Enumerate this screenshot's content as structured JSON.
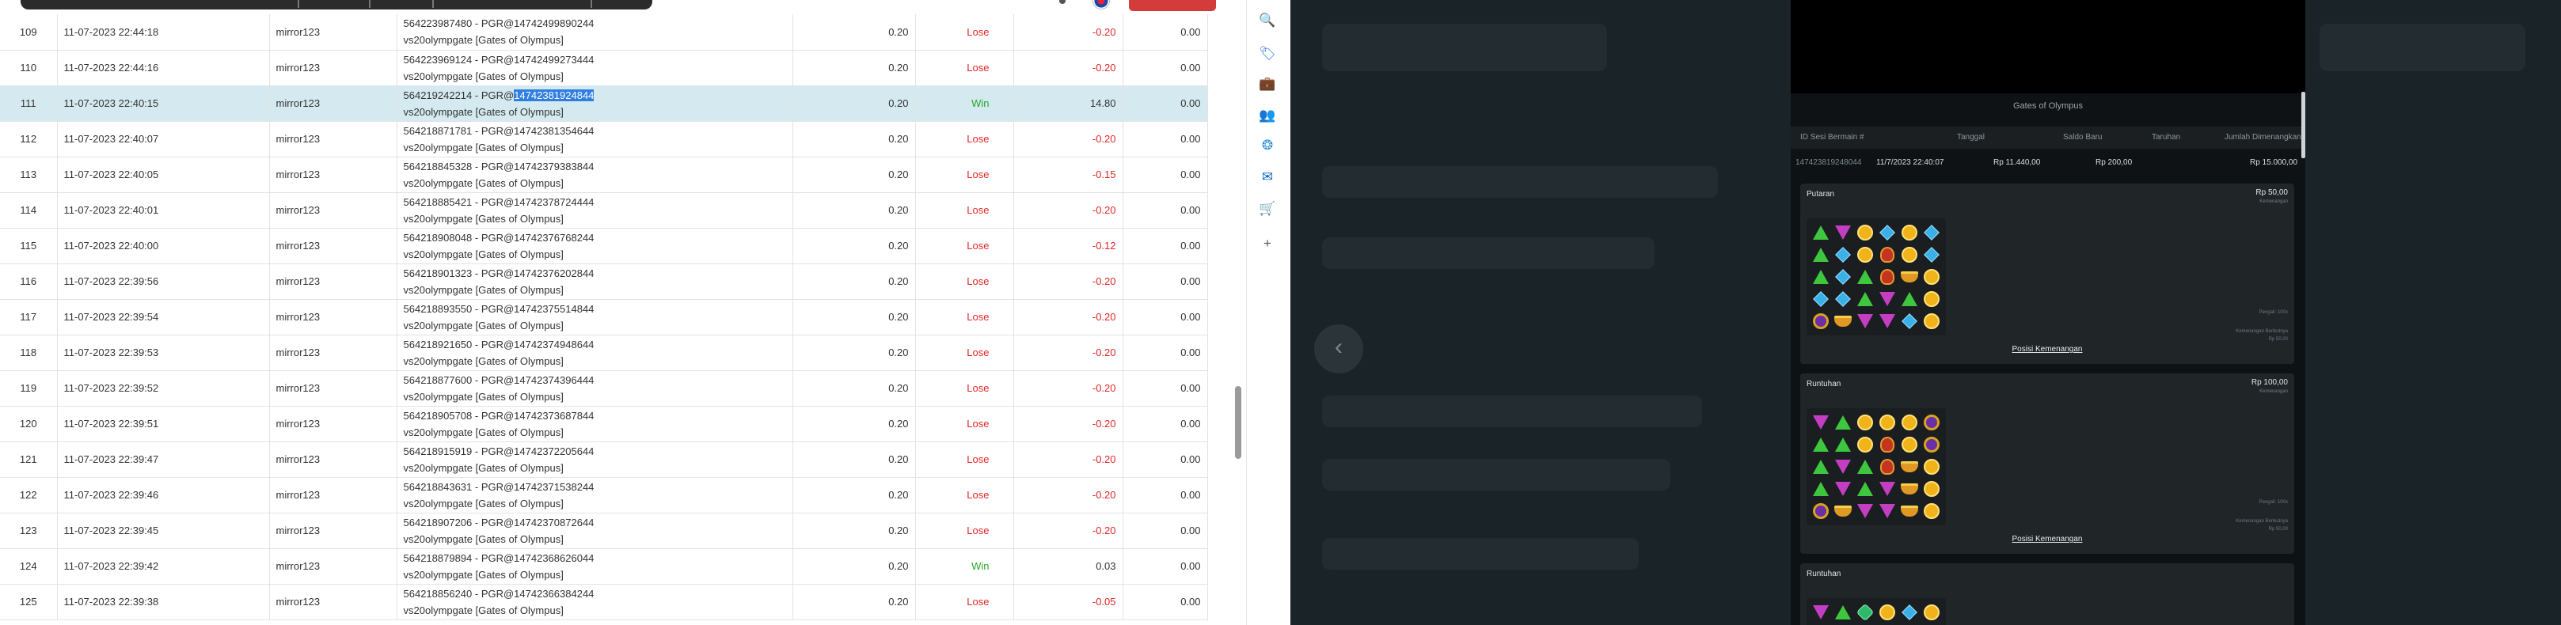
{
  "table": {
    "rows": [
      {
        "no": "109",
        "datetime": "11-07-2023 22:44:18",
        "user": "mirror123",
        "desc1": "564223987480 - PGR@14742499890244",
        "desc2": "vs20olympgate [Gates of Olympus]",
        "bet": "0.20",
        "result": "Lose",
        "winloss": "-0.20",
        "extra": "0.00"
      },
      {
        "no": "110",
        "datetime": "11-07-2023 22:44:16",
        "user": "mirror123",
        "desc1": "564223969124 - PGR@14742499273444",
        "desc2": "vs20olympgate [Gates of Olympus]",
        "bet": "0.20",
        "result": "Lose",
        "winloss": "-0.20",
        "extra": "0.00"
      },
      {
        "no": "111",
        "datetime": "11-07-2023 22:40:15",
        "user": "mirror123",
        "desc1": "564219242214 - PGR@",
        "desc1_hl": "14742381924844",
        "desc2": "vs20olympgate [Gates of Olympus]",
        "bet": "0.20",
        "result": "Win",
        "winloss": "14.80",
        "extra": "0.00",
        "selected": true
      },
      {
        "no": "112",
        "datetime": "11-07-2023 22:40:07",
        "user": "mirror123",
        "desc1": "564218871781 - PGR@14742381354644",
        "desc2": "vs20olympgate [Gates of Olympus]",
        "bet": "0.20",
        "result": "Lose",
        "winloss": "-0.20",
        "extra": "0.00"
      },
      {
        "no": "113",
        "datetime": "11-07-2023 22:40:05",
        "user": "mirror123",
        "desc1": "564218845328 - PGR@14742379383844",
        "desc2": "vs20olympgate [Gates of Olympus]",
        "bet": "0.20",
        "result": "Lose",
        "winloss": "-0.15",
        "extra": "0.00"
      },
      {
        "no": "114",
        "datetime": "11-07-2023 22:40:01",
        "user": "mirror123",
        "desc1": "564218885421 - PGR@14742378724444",
        "desc2": "vs20olympgate [Gates of Olympus]",
        "bet": "0.20",
        "result": "Lose",
        "winloss": "-0.20",
        "extra": "0.00"
      },
      {
        "no": "115",
        "datetime": "11-07-2023 22:40:00",
        "user": "mirror123",
        "desc1": "564218908048 - PGR@14742376768244",
        "desc2": "vs20olympgate [Gates of Olympus]",
        "bet": "0.20",
        "result": "Lose",
        "winloss": "-0.12",
        "extra": "0.00"
      },
      {
        "no": "116",
        "datetime": "11-07-2023 22:39:56",
        "user": "mirror123",
        "desc1": "564218901323 - PGR@14742376202844",
        "desc2": "vs20olympgate [Gates of Olympus]",
        "bet": "0.20",
        "result": "Lose",
        "winloss": "-0.20",
        "extra": "0.00"
      },
      {
        "no": "117",
        "datetime": "11-07-2023 22:39:54",
        "user": "mirror123",
        "desc1": "564218893550 - PGR@14742375514844",
        "desc2": "vs20olympgate [Gates of Olympus]",
        "bet": "0.20",
        "result": "Lose",
        "winloss": "-0.20",
        "extra": "0.00"
      },
      {
        "no": "118",
        "datetime": "11-07-2023 22:39:53",
        "user": "mirror123",
        "desc1": "564218921650 - PGR@14742374948644",
        "desc2": "vs20olympgate [Gates of Olympus]",
        "bet": "0.20",
        "result": "Lose",
        "winloss": "-0.20",
        "extra": "0.00"
      },
      {
        "no": "119",
        "datetime": "11-07-2023 22:39:52",
        "user": "mirror123",
        "desc1": "564218877600 - PGR@14742374396444",
        "desc2": "vs20olympgate [Gates of Olympus]",
        "bet": "0.20",
        "result": "Lose",
        "winloss": "-0.20",
        "extra": "0.00"
      },
      {
        "no": "120",
        "datetime": "11-07-2023 22:39:51",
        "user": "mirror123",
        "desc1": "564218905708 - PGR@14742373687844",
        "desc2": "vs20olympgate [Gates of Olympus]",
        "bet": "0.20",
        "result": "Lose",
        "winloss": "-0.20",
        "extra": "0.00"
      },
      {
        "no": "121",
        "datetime": "11-07-2023 22:39:47",
        "user": "mirror123",
        "desc1": "564218915919 - PGR@14742372205644",
        "desc2": "vs20olympgate [Gates of Olympus]",
        "bet": "0.20",
        "result": "Lose",
        "winloss": "-0.20",
        "extra": "0.00"
      },
      {
        "no": "122",
        "datetime": "11-07-2023 22:39:46",
        "user": "mirror123",
        "desc1": "564218843631 - PGR@14742371538244",
        "desc2": "vs20olympgate [Gates of Olympus]",
        "bet": "0.20",
        "result": "Lose",
        "winloss": "-0.20",
        "extra": "0.00"
      },
      {
        "no": "123",
        "datetime": "11-07-2023 22:39:45",
        "user": "mirror123",
        "desc1": "564218907206 - PGR@14742370872644",
        "desc2": "vs20olympgate [Gates of Olympus]",
        "bet": "0.20",
        "result": "Lose",
        "winloss": "-0.20",
        "extra": "0.00"
      },
      {
        "no": "124",
        "datetime": "11-07-2023 22:39:42",
        "user": "mirror123",
        "desc1": "564218879894 - PGR@14742368626044",
        "desc2": "vs20olympgate [Gates of Olympus]",
        "bet": "0.20",
        "result": "Win",
        "winloss": "0.03",
        "extra": "0.00"
      },
      {
        "no": "125",
        "datetime": "11-07-2023 22:39:38",
        "user": "mirror123",
        "desc1": "564218856240 - PGR@14742366384244",
        "desc2": "vs20olympgate [Gates of Olympus]",
        "bet": "0.20",
        "result": "Lose",
        "winloss": "-0.05",
        "extra": "0.00"
      }
    ]
  },
  "sidebar_icons": [
    "search-icon",
    "tag-icon",
    "briefcase-icon",
    "people-icon",
    "copilot-icon",
    "outlook-icon",
    "shopping-icon",
    "add-icon"
  ],
  "sidebar_glyphs": [
    "🔍",
    "🏷",
    "💼",
    "👥",
    "❂",
    "✉",
    "🛒",
    "+"
  ],
  "sidebar_colors": [
    "#1e6fd9",
    "#2a7ae2",
    "#c8502a",
    "#7b4fc0",
    "#2f8fd8",
    "#0a64c8",
    "#1aa06b",
    "#555555"
  ],
  "modal": {
    "title": "Gates of Olympus",
    "headers": [
      "ID Sesi Bermain #",
      "Tanggal",
      "Saldo Baru",
      "Taruhan",
      "Jumlah Dimenangkan"
    ],
    "row": [
      "147423819248044",
      "11/7/2023 22:40:07",
      "Rp 11.440,00",
      "Rp 200,00",
      "Rp 15.000,00"
    ],
    "panels": [
      {
        "title": "Putaran",
        "amount": "Rp 50,00",
        "sub": "Kemenangan",
        "link": "Posisi Kemenangan",
        "note1": "Pengali: 100x",
        "note2": "Kemenangan Berikutnya",
        "note3": "Rp 50,00"
      },
      {
        "title": "Runtuhan",
        "amount": "Rp 100,00",
        "sub": "Kemenangan",
        "link": "Posisi Kemenangan",
        "note1": "Pengali: 100x",
        "note2": "Kemenangan Berikutnya",
        "note3": "Rp 50,00"
      },
      {
        "title": "Runtuhan",
        "amount": "",
        "sub": "",
        "link": "",
        "note1": "",
        "note2": "",
        "note3": ""
      }
    ],
    "grids": [
      [
        "tri-g",
        "tri-p",
        "hex-y",
        "gem-b",
        "hex-y",
        "gem-b",
        "tri-g",
        "gem-b",
        "hex-y",
        "red",
        "hex-y",
        "gem-b",
        "tri-g",
        "gem-b",
        "tri-g",
        "red",
        "cup",
        "hex-y",
        "gem-b",
        "gem-b",
        "tri-g",
        "tri-p",
        "tri-g",
        "hex-y",
        "ring",
        "cup",
        "tri-p",
        "tri-p",
        "gem-b",
        "hex-y"
      ],
      [
        "tri-p",
        "tri-g",
        "hex-y",
        "hex-y",
        "hex-y",
        "ring",
        "tri-g",
        "tri-g",
        "hex-y",
        "red",
        "hex-y",
        "ring",
        "tri-g",
        "tri-p",
        "tri-g",
        "red",
        "cup",
        "hex-y",
        "tri-g",
        "tri-p",
        "tri-g",
        "tri-p",
        "cup",
        "hex-y",
        "ring",
        "cup",
        "tri-p",
        "tri-p",
        "cup",
        "hex-y"
      ],
      [
        "tri-p",
        "tri-g",
        "gem-g",
        "hex-y",
        "gem-b",
        "hex-y"
      ]
    ]
  }
}
